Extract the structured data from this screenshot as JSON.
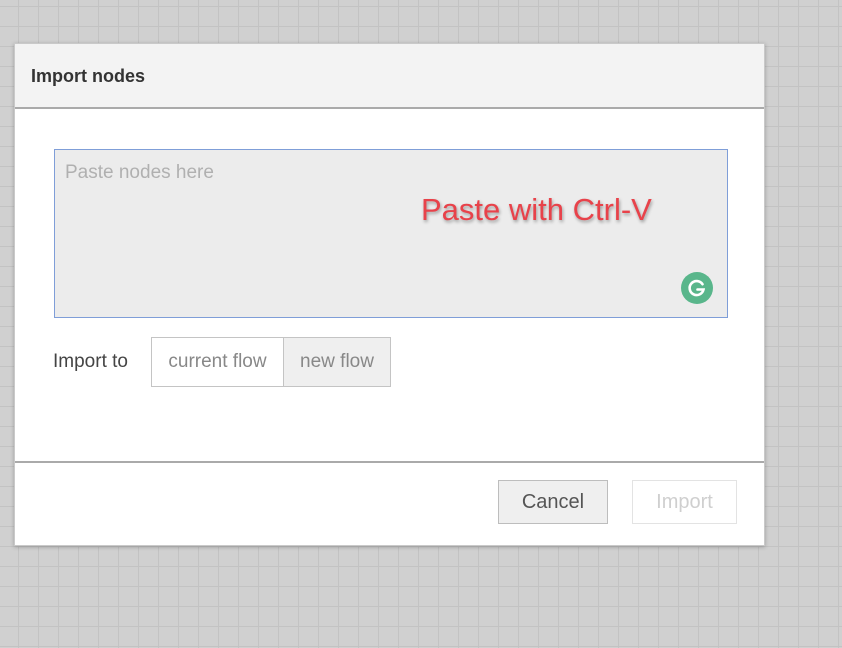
{
  "dialog": {
    "title": "Import nodes",
    "paste_area": {
      "placeholder": "Paste nodes here",
      "value": ""
    },
    "annotation": "Paste with Ctrl-V",
    "grammarly_icon": "grammarly-g-icon",
    "import_to": {
      "label": "Import to",
      "options": [
        "current flow",
        "new flow"
      ],
      "selected": "current flow"
    },
    "buttons": {
      "cancel": "Cancel",
      "import": "Import"
    }
  },
  "colors": {
    "canvas_bg": "#d0d0d0",
    "annotation_red": "#e8424a",
    "grammarly_green": "#59b68b",
    "textarea_border": "#7f9ed8"
  }
}
